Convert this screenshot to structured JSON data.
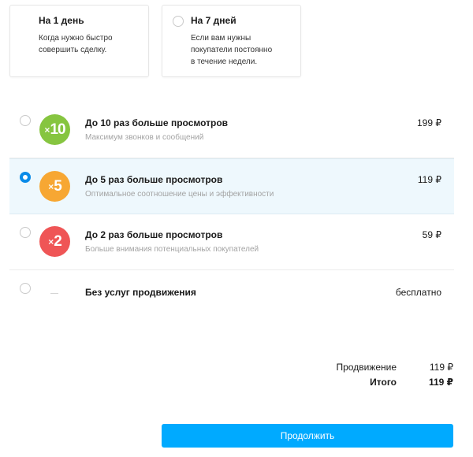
{
  "duration": {
    "options": [
      {
        "title": "На 1 день",
        "desc": [
          "Когда нужно быстро",
          "совершить сделку."
        ],
        "selected": true
      },
      {
        "title": "На 7 дней",
        "desc": [
          "Если вам нужны",
          "покупатели постоянно",
          "в течение недели."
        ],
        "selected": false
      }
    ]
  },
  "promotion": {
    "options": [
      {
        "badge": "10",
        "badge_color": "#86c540",
        "icon": "x10-badge-icon",
        "title": "До 10 раз больше просмотров",
        "subtitle": "Максимум звонков и сообщений",
        "price": "199 ₽",
        "selected": false
      },
      {
        "badge": "5",
        "badge_color": "#f7a733",
        "icon": "x5-badge-icon",
        "title": "До 5 раз больше просмотров",
        "subtitle": "Оптимальное соотношение цены и эффективности",
        "price": "119 ₽",
        "selected": true
      },
      {
        "badge": "2",
        "badge_color": "#ef5556",
        "icon": "x2-badge-icon",
        "title": "До 2 раз больше просмотров",
        "subtitle": "Больше внимания потенциальных покупателей",
        "price": "59 ₽",
        "selected": false
      },
      {
        "title": "Без услуг продвижения",
        "price": "бесплатно",
        "selected": false
      }
    ]
  },
  "summary": {
    "promotion_label": "Продвижение",
    "promotion_value": "119 ₽",
    "total_label": "Итого",
    "total_value": "119 ₽"
  },
  "continue_label": "Продолжить",
  "colors": {
    "accent": "#0a8be8",
    "button": "#00aaff",
    "selected_row": "#eef8fd"
  }
}
